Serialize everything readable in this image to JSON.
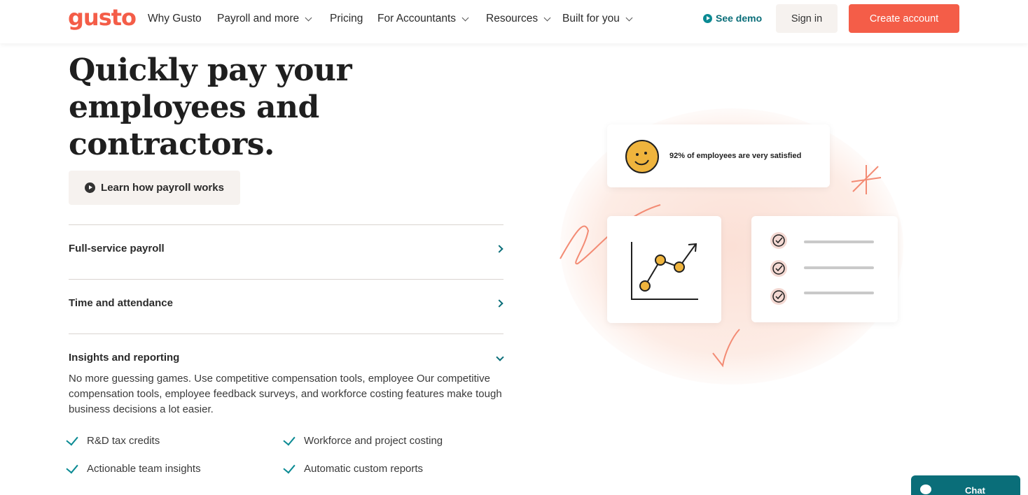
{
  "nav": {
    "logo": "gusto",
    "items": [
      {
        "label": "Why Gusto",
        "dropdown": false
      },
      {
        "label": "Payroll and more",
        "dropdown": true
      },
      {
        "label": "Pricing",
        "dropdown": false
      },
      {
        "label": "For Accountants",
        "dropdown": true
      },
      {
        "label": "Resources",
        "dropdown": true
      },
      {
        "label": "Built for you",
        "dropdown": true
      }
    ],
    "see_demo": "See demo",
    "sign_in": "Sign in",
    "create_account": "Create account"
  },
  "hero": {
    "title": "Quickly pay your employees and contractors.",
    "learn_button": "Learn how payroll works"
  },
  "accordion": {
    "items": [
      {
        "title": "Full-service payroll",
        "expanded": false
      },
      {
        "title": "Time and attendance",
        "expanded": false
      },
      {
        "title": "Insights and reporting",
        "expanded": true
      }
    ],
    "description": "No more guessing games. Use competitive compensation tools, employee Our competitive compensation tools, employee feedback surveys, and workforce costing features make tough business decisions a lot easier.",
    "features": [
      "R&D tax credits",
      "Workforce and project costing",
      "Actionable team insights",
      "Automatic custom reports"
    ]
  },
  "illustration": {
    "satisfaction_text": "92% of employees are very satisfied"
  },
  "chat": {
    "label": "Chat"
  },
  "colors": {
    "brand": "#f45d48",
    "accent": "#0a6e79",
    "button_bg": "#f6f2ef"
  }
}
